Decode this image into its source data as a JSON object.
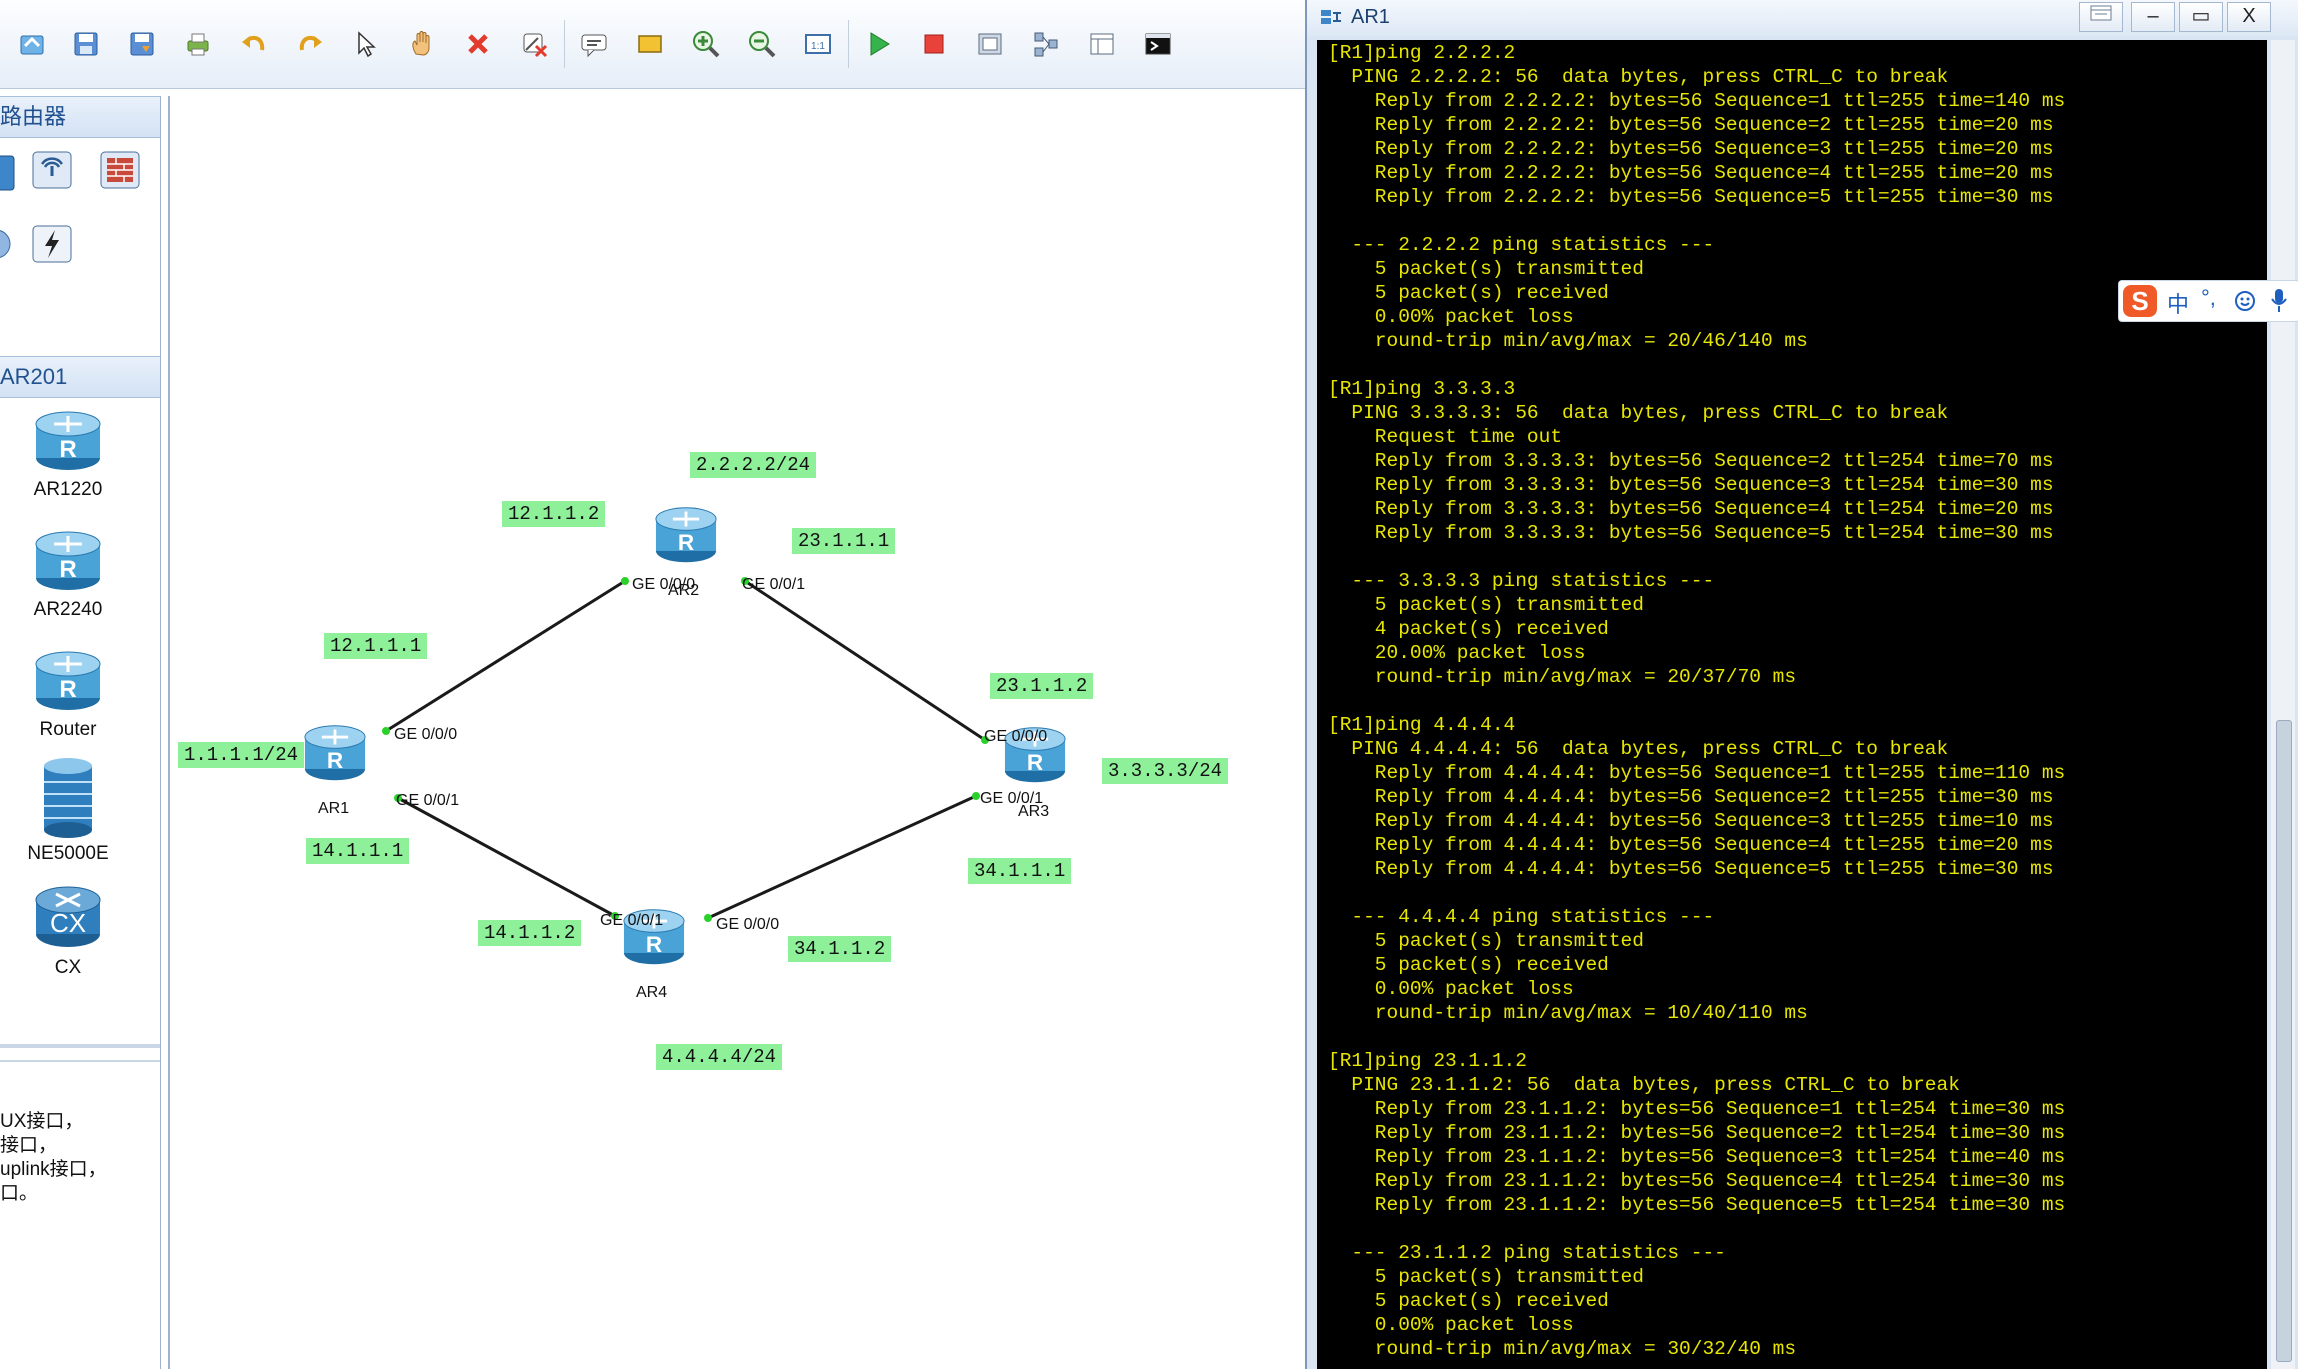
{
  "toolbar": {
    "icons": [
      "home-icon",
      "save-icon",
      "save-as-icon",
      "print-icon",
      "undo-icon",
      "redo-icon",
      "select-icon",
      "pan-hand-icon",
      "delete-icon",
      "delete-link-icon",
      "text-note-icon",
      "rectangle-icon",
      "zoom-in-icon",
      "zoom-out-icon",
      "fit-view-icon",
      "start-device-icon",
      "stop-device-icon",
      "capture-icon",
      "topology-icon",
      "palette-icon",
      "console-icon"
    ]
  },
  "left_panel": {
    "category_title": "路由器",
    "model_title": "AR201",
    "devices": [
      {
        "label": "AR1220"
      },
      {
        "label": "AR2240"
      },
      {
        "label": "Router"
      },
      {
        "label": "NE5000E"
      },
      {
        "label": "CX"
      }
    ],
    "description_lines": [
      "UX接口，",
      "接口，",
      "uplink接口，",
      "口。"
    ]
  },
  "topology": {
    "routers": [
      {
        "name": "AR1"
      },
      {
        "name": "AR2"
      },
      {
        "name": "AR3"
      },
      {
        "name": "AR4"
      }
    ],
    "ports": {
      "ar1_ge000": "GE 0/0/0",
      "ar1_ge001": "GE 0/0/1",
      "ar2_ge000": "GE 0/0/0",
      "ar2_ge001": "GE 0/0/1",
      "ar3_ge000": "GE 0/0/0",
      "ar3_ge001": "GE 0/0/1",
      "ar4_ge001": "GE 0/0/1",
      "ar4_ge000": "GE 0/0/0"
    },
    "labels": {
      "ar2_loopback": "2.2.2.2/24",
      "ar2_link12": "12.1.1.2",
      "ar2_link23": "23.1.1.1",
      "ar1_link12": "12.1.1.1",
      "ar3_link23": "23.1.1.2",
      "ar1_loopback": "1.1.1.1/24",
      "ar3_loopback": "3.3.3.3/24",
      "ar1_link14": "14.1.1.1",
      "ar3_link34": "34.1.1.1",
      "ar4_link14": "14.1.1.2",
      "ar4_link34": "34.1.1.2",
      "ar4_loopback": "4.4.4.4/24"
    },
    "link_color": "#1a1a1a",
    "port_dot_color": "#2bd12b",
    "label_bg": "#8ff09a"
  },
  "terminal": {
    "title": "AR1",
    "buttons": {
      "minimize": "–",
      "maximize": "▭",
      "close": "X"
    },
    "text_color": "#e6e600",
    "background": "#000000",
    "text": "[R1]ping 2.2.2.2\n  PING 2.2.2.2: 56  data bytes, press CTRL_C to break\n    Reply from 2.2.2.2: bytes=56 Sequence=1 ttl=255 time=140 ms\n    Reply from 2.2.2.2: bytes=56 Sequence=2 ttl=255 time=20 ms\n    Reply from 2.2.2.2: bytes=56 Sequence=3 ttl=255 time=20 ms\n    Reply from 2.2.2.2: bytes=56 Sequence=4 ttl=255 time=20 ms\n    Reply from 2.2.2.2: bytes=56 Sequence=5 ttl=255 time=30 ms\n\n  --- 2.2.2.2 ping statistics ---\n    5 packet(s) transmitted\n    5 packet(s) received\n    0.00% packet loss\n    round-trip min/avg/max = 20/46/140 ms\n\n[R1]ping 3.3.3.3\n  PING 3.3.3.3: 56  data bytes, press CTRL_C to break\n    Request time out\n    Reply from 3.3.3.3: bytes=56 Sequence=2 ttl=254 time=70 ms\n    Reply from 3.3.3.3: bytes=56 Sequence=3 ttl=254 time=30 ms\n    Reply from 3.3.3.3: bytes=56 Sequence=4 ttl=254 time=20 ms\n    Reply from 3.3.3.3: bytes=56 Sequence=5 ttl=254 time=30 ms\n\n  --- 3.3.3.3 ping statistics ---\n    5 packet(s) transmitted\n    4 packet(s) received\n    20.00% packet loss\n    round-trip min/avg/max = 20/37/70 ms\n\n[R1]ping 4.4.4.4\n  PING 4.4.4.4: 56  data bytes, press CTRL_C to break\n    Reply from 4.4.4.4: bytes=56 Sequence=1 ttl=255 time=110 ms\n    Reply from 4.4.4.4: bytes=56 Sequence=2 ttl=255 time=30 ms\n    Reply from 4.4.4.4: bytes=56 Sequence=3 ttl=255 time=10 ms\n    Reply from 4.4.4.4: bytes=56 Sequence=4 ttl=255 time=20 ms\n    Reply from 4.4.4.4: bytes=56 Sequence=5 ttl=255 time=30 ms\n\n  --- 4.4.4.4 ping statistics ---\n    5 packet(s) transmitted\n    5 packet(s) received\n    0.00% packet loss\n    round-trip min/avg/max = 10/40/110 ms\n\n[R1]ping 23.1.1.2\n  PING 23.1.1.2: 56  data bytes, press CTRL_C to break\n    Reply from 23.1.1.2: bytes=56 Sequence=1 ttl=254 time=30 ms\n    Reply from 23.1.1.2: bytes=56 Sequence=2 ttl=254 time=30 ms\n    Reply from 23.1.1.2: bytes=56 Sequence=3 ttl=254 time=40 ms\n    Reply from 23.1.1.2: bytes=56 Sequence=4 ttl=254 time=30 ms\n    Reply from 23.1.1.2: bytes=56 Sequence=5 ttl=254 time=30 ms\n\n  --- 23.1.1.2 ping statistics ---\n    5 packet(s) transmitted\n    5 packet(s) received\n    0.00% packet loss\n    round-trip min/avg/max = 30/32/40 ms"
  },
  "ime": {
    "logo": "S",
    "mode": "中",
    "punct": "°,",
    "icons": [
      "sogou-logo-icon",
      "emoji-icon",
      "microphone-icon"
    ]
  }
}
